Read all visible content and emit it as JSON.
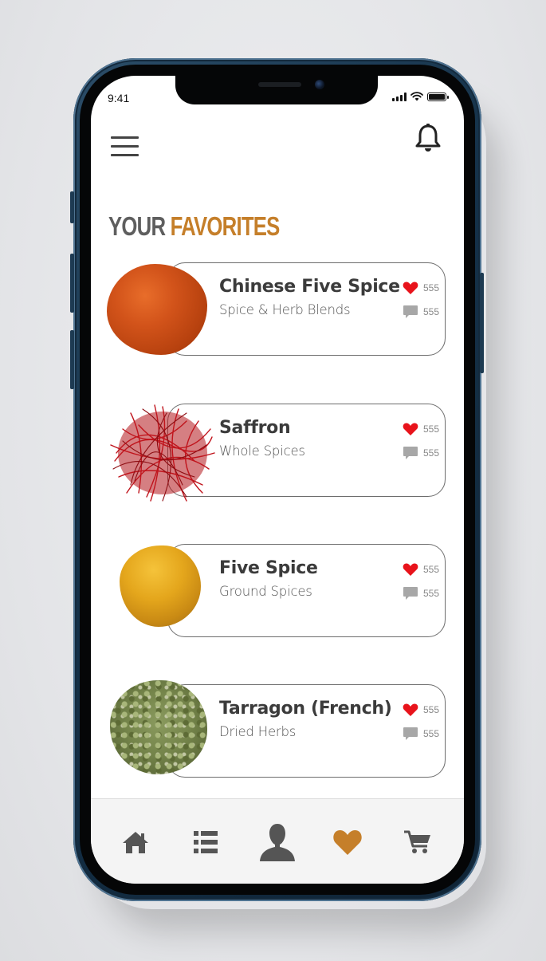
{
  "status_bar": {
    "time": "9:41"
  },
  "header": {
    "menu_icon": "hamburger-menu-icon",
    "notification_icon": "bell-icon"
  },
  "section": {
    "title_word_1": "YOUR",
    "title_word_2": "FAVORITES"
  },
  "colors": {
    "accent": "#c57f2a",
    "title_gray": "#5e5e5e",
    "heart": "#e8131b",
    "comment": "#a7a7a7",
    "card_border": "#6d6d6d",
    "tab_icon": "#555555"
  },
  "favorites": [
    {
      "name": "Chinese Five Spice",
      "category": "Spice & Herb Blends",
      "likes": "555",
      "comments": "555",
      "image": "red-orange powder mound"
    },
    {
      "name": "Saffron",
      "category": "Whole Spices",
      "likes": "555",
      "comments": "555",
      "image": "red saffron threads"
    },
    {
      "name": "Five Spice",
      "category": "Ground Spices",
      "likes": "555",
      "comments": "555",
      "image": "yellow powder mound"
    },
    {
      "name": "Tarragon (French)",
      "category": "Dried Herbs",
      "likes": "555",
      "comments": "555",
      "image": "green dried herb pile"
    }
  ],
  "tabs": [
    {
      "name": "home",
      "icon": "home-icon",
      "active": false
    },
    {
      "name": "list",
      "icon": "list-icon",
      "active": false
    },
    {
      "name": "profile",
      "icon": "profile-icon",
      "active": false
    },
    {
      "name": "favorites",
      "icon": "heart-icon",
      "active": true
    },
    {
      "name": "cart",
      "icon": "cart-icon",
      "active": false
    }
  ]
}
